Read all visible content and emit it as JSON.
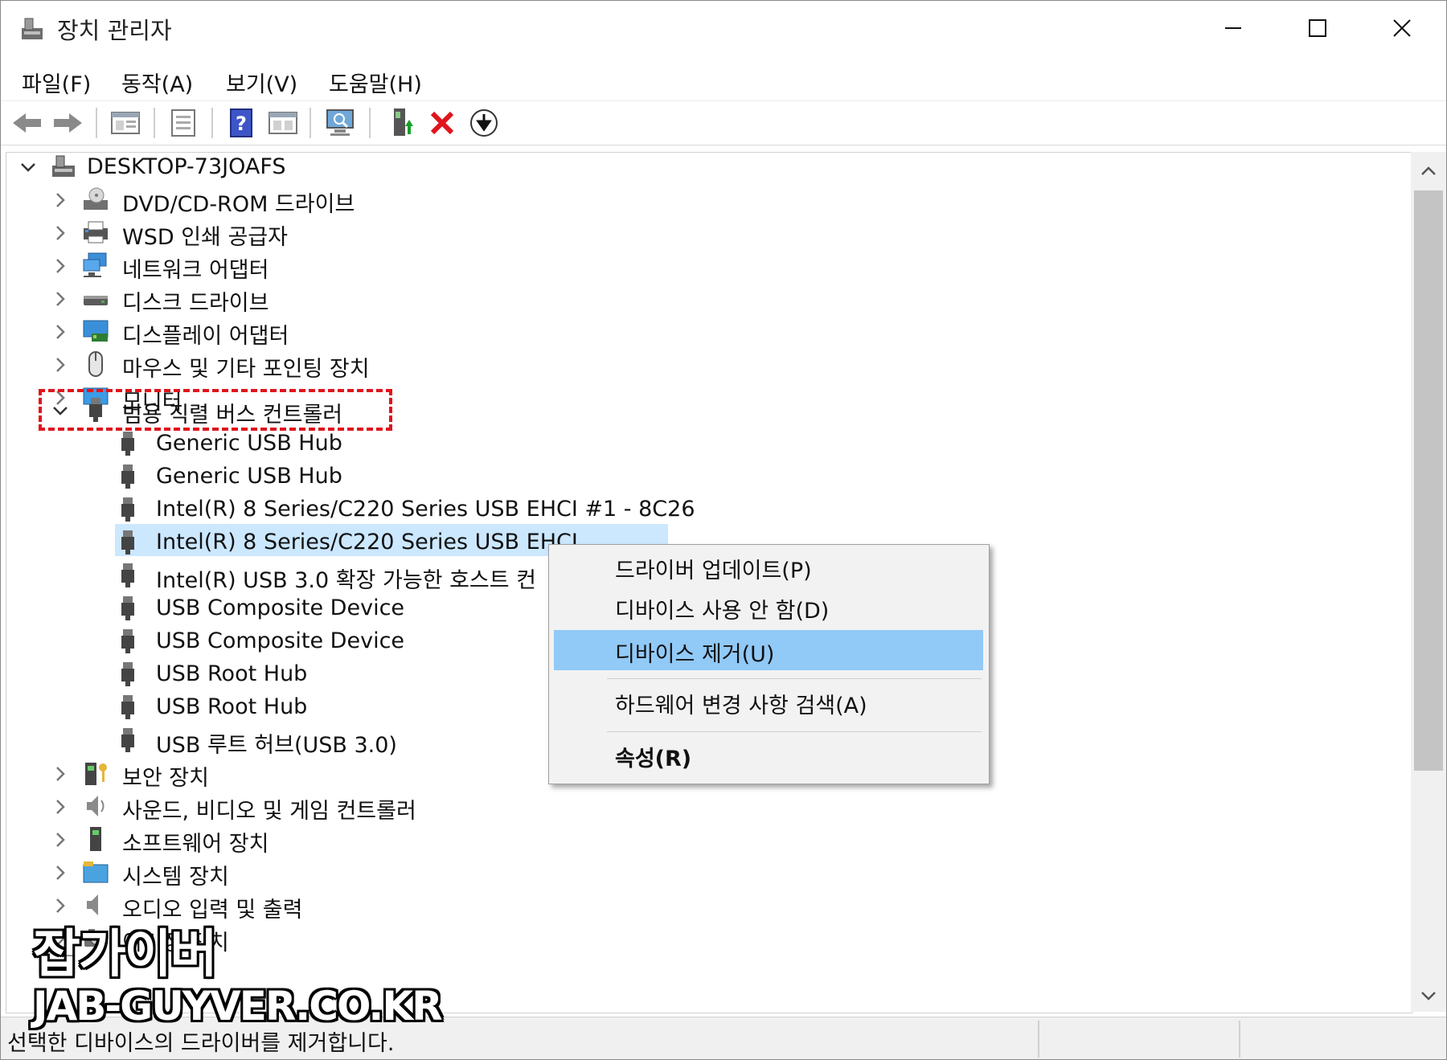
{
  "window": {
    "title": "장치 관리자"
  },
  "menu": [
    "파일(F)",
    "동작(A)",
    "보기(V)",
    "도움말(H)"
  ],
  "tree": {
    "root": "DESKTOP-73JOAFS",
    "categories_before": [
      {
        "label": "DVD/CD-ROM 드라이브",
        "icon": "dvd-drive-icon"
      },
      {
        "label": "WSD 인쇄 공급자",
        "icon": "printer-icon"
      },
      {
        "label": "네트워크 어댑터",
        "icon": "network-adapter-icon"
      },
      {
        "label": "디스크 드라이브",
        "icon": "disk-drive-icon"
      },
      {
        "label": "디스플레이 어댑터",
        "icon": "display-adapter-icon"
      },
      {
        "label": "마우스 및 기타 포인팅 장치",
        "icon": "mouse-icon"
      },
      {
        "label": "모니터",
        "icon": "monitor-icon"
      }
    ],
    "expanded_category": "범용 직렬 버스 컨트롤러",
    "usb_devices": [
      "Generic USB Hub",
      "Generic USB Hub",
      "Intel(R) 8 Series/C220 Series USB EHCI #1 - 8C26",
      "Intel(R) 8 Series/C220 Series USB EHCI",
      "Intel(R) USB 3.0 확장 가능한 호스트 컨",
      "USB Composite Device",
      "USB Composite Device",
      "USB Root Hub",
      "USB Root Hub",
      "USB 루트 허브(USB 3.0)"
    ],
    "categories_after": [
      {
        "label": "보안 장치",
        "icon": "security-device-icon"
      },
      {
        "label": "사운드, 비디오 및 게임 컨트롤러",
        "icon": "speaker-icon"
      },
      {
        "label": "소프트웨어 장치",
        "icon": "software-device-icon"
      },
      {
        "label": "시스템 장치",
        "icon": "system-device-icon"
      },
      {
        "label": "오디오 입력 및 출력",
        "icon": "audio-io-icon"
      },
      {
        "label": "이미징 장치",
        "icon": "imaging-device-icon"
      }
    ]
  },
  "context_menu": [
    "드라이버 업데이트(P)",
    "디바이스 사용 안 함(D)",
    "디바이스 제거(U)",
    "하드웨어 변경 사항 검색(A)",
    "속성(R)"
  ],
  "status": "선택한 디바이스의 드라이버를 제거합니다.",
  "watermark": {
    "line1": "잡가이버",
    "line2": "JAB-GUYVER.CO.KR"
  },
  "colors": {
    "selection": "#cce8ff",
    "menu_hover": "#91c9f7",
    "highlight_box": "#e0141c"
  }
}
